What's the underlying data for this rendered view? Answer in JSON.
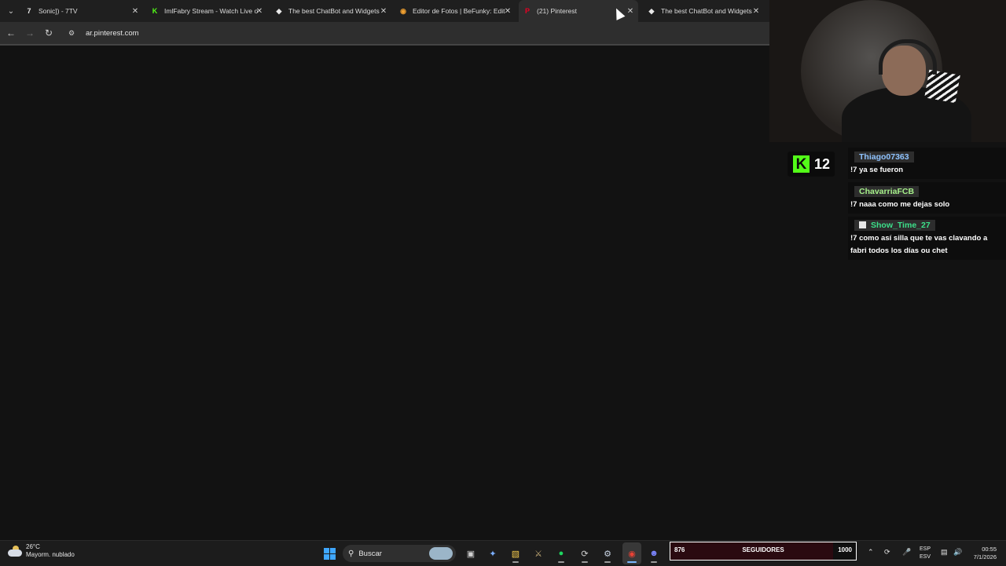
{
  "browser": {
    "tabs": [
      {
        "title": "Sonic]) - 7TV",
        "icon": "7tv-icon",
        "color": "#e8e8e8",
        "active": false
      },
      {
        "title": "ImlFabry Stream - Watch Live o",
        "icon": "kick-icon",
        "color": "#53fc18",
        "active": false
      },
      {
        "title": "The best ChatBot and Widgets",
        "icon": "streamelements-icon",
        "color": "#e8e8e8",
        "active": false
      },
      {
        "title": "Editor de Fotos | BeFunky: Edit",
        "icon": "befunky-icon",
        "color": "#f0a030",
        "active": false
      },
      {
        "title": "(21) Pinterest",
        "icon": "pinterest-icon",
        "color": "#e60023",
        "active": true
      },
      {
        "title": "The best ChatBot and Widgets",
        "icon": "streamelements-icon",
        "color": "#e8e8e8",
        "active": false
      }
    ],
    "url": "ar.pinterest.com"
  },
  "overlay": {
    "kick_viewers": "12",
    "chat": [
      {
        "user": "Thiago07363",
        "user_color": "#8fc3ff",
        "text": "!7 ya se fueron",
        "badge": false
      },
      {
        "user": "ChavarriaFCB",
        "user_color": "#a6f08a",
        "text": "!7 naaa como me dejas solo",
        "badge": false
      },
      {
        "user": "Show_Time_27",
        "user_color": "#3ce08a",
        "text": "!7 como así silla que te vas clavando a fabri todos los días ou chet",
        "badge": true
      }
    ]
  },
  "taskbar": {
    "weather_temp": "26°C",
    "weather_desc": "Mayorm. nublado",
    "search_placeholder": "Buscar",
    "goal_current": "876",
    "goal_label": "SEGUIDORES",
    "goal_target": "1000",
    "goal_progress": 0.876,
    "lang_top": "ESP",
    "lang_bottom": "ESV",
    "time": "00:55",
    "date": "7/1/2026"
  }
}
